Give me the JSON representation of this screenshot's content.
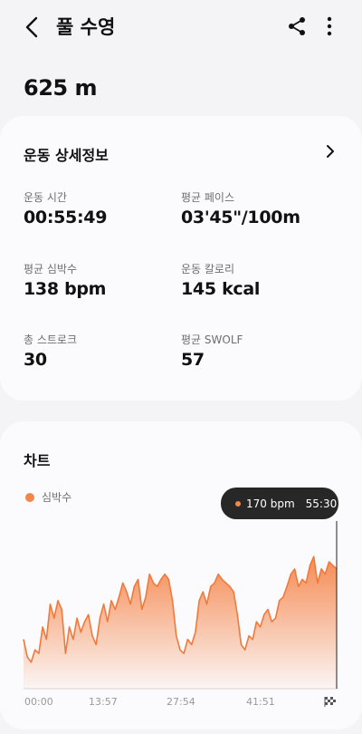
{
  "header": {
    "title": "풀 수영",
    "distance": "625 m"
  },
  "details": {
    "section_title": "운동 상세정보",
    "stats": [
      {
        "label": "운동 시간",
        "value": "00:55:49"
      },
      {
        "label": "평균 페이스",
        "value": "03'45\"/100m"
      },
      {
        "label": "평균 심박수",
        "value": "138 bpm"
      },
      {
        "label": "운동 칼로리",
        "value": "145 kcal"
      },
      {
        "label": "총 스트로크",
        "value": "30"
      },
      {
        "label": "평균 SWOLF",
        "value": "57"
      }
    ]
  },
  "chart_section": {
    "title": "차트",
    "legend": "심박수",
    "tooltip": {
      "value": "170 bpm",
      "time": "55:30"
    }
  },
  "colors": {
    "accent": "#f5854a",
    "tooltip_bg": "#272727",
    "card_bg": "#fbfbfd",
    "page_bg": "#f4f4f6"
  },
  "chart_data": {
    "type": "area",
    "series": [
      {
        "name": "심박수",
        "values": [
          128,
          118,
          115,
          122,
          120,
          135,
          128,
          148,
          140,
          150,
          145,
          120,
          135,
          128,
          140,
          132,
          138,
          142,
          130,
          125,
          140,
          148,
          138,
          150,
          145,
          152,
          160,
          155,
          148,
          158,
          162,
          145,
          152,
          165,
          160,
          158,
          162,
          165,
          162,
          150,
          130,
          122,
          120,
          128,
          125,
          132,
          150,
          155,
          148,
          158,
          160,
          165,
          162,
          160,
          158,
          155,
          142,
          125,
          122,
          130,
          128,
          138,
          135,
          142,
          145,
          138,
          140,
          150,
          152,
          158,
          165,
          168,
          158,
          162,
          160,
          170,
          175,
          160,
          168,
          165,
          172,
          170,
          168
        ]
      }
    ],
    "xtick_labels": [
      "00:00",
      "13:57",
      "27:54",
      "41:51"
    ],
    "x_end_icon": "checkered-flag-icon",
    "ylim": [
      100,
      190
    ],
    "grid": false,
    "highlight": {
      "value": 170,
      "time": "55:30"
    }
  }
}
